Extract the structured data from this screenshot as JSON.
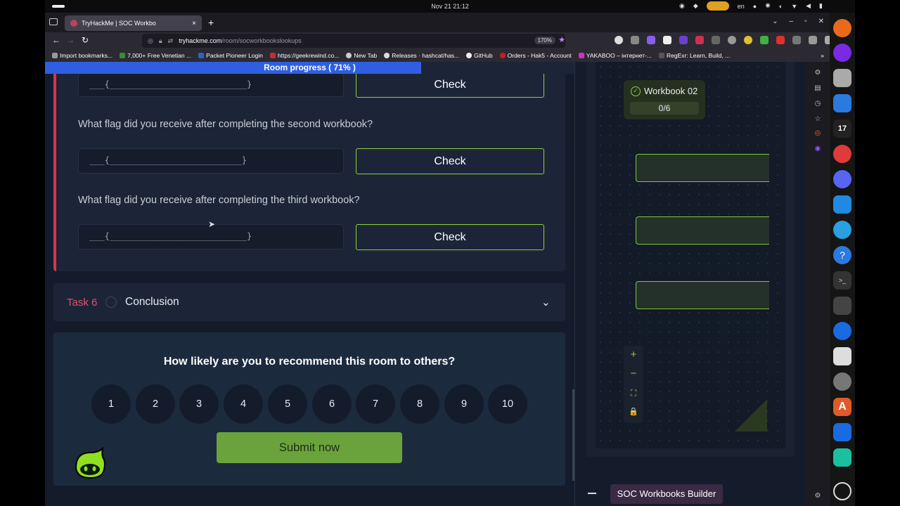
{
  "system": {
    "clock": "Nov 21  21:12",
    "lang": "en"
  },
  "browser": {
    "tab_title": "TryHackMe | SOC Workbo",
    "tab_close": "×",
    "new_tab": "+",
    "url_host": "tryhackme.com",
    "url_path": "/room/socworkbookslookups",
    "zoom": "170%",
    "bookmarks": [
      "Import bookmarks...",
      "7,000+ Free Venetian ...",
      "Packet Pioneer Login",
      "https://geekrewind.co...",
      "New Tab",
      "Releases · hashcat/has...",
      "GitHub",
      "Orders - Hak5 - Account",
      "YAKABOO – інтернет-...",
      "RegExr: Learn, Build, ..."
    ]
  },
  "room": {
    "progress_label": "Room progress ( 71% )",
    "progress_value": 0.71,
    "questions": [
      {
        "text": "",
        "placeholder": "___{___________________________}",
        "button": "Check"
      },
      {
        "text": "What flag did you receive after completing the second workbook?",
        "placeholder": "___{__________________________}",
        "button": "Check"
      },
      {
        "text": "What flag did you receive after completing the third workbook?",
        "placeholder": "___{___________________________}",
        "button": "Check"
      }
    ],
    "task6": {
      "number": "Task 6",
      "title": "Conclusion"
    },
    "rating": {
      "question": "How likely are you to recommend this room to others?",
      "options": [
        "1",
        "2",
        "3",
        "4",
        "5",
        "6",
        "7",
        "8",
        "9",
        "10"
      ],
      "submit": "Submit now"
    }
  },
  "workbook": {
    "node_title": "Workbook 02",
    "node_count": "0/6",
    "controls": [
      "+",
      "−",
      "⛶",
      "🔒"
    ],
    "app_button": "SOC Workbooks Builder"
  },
  "colors": {
    "accent_green": "#8fce3a",
    "task_red": "#e0304e",
    "progress_blue": "#2f5fe0"
  }
}
